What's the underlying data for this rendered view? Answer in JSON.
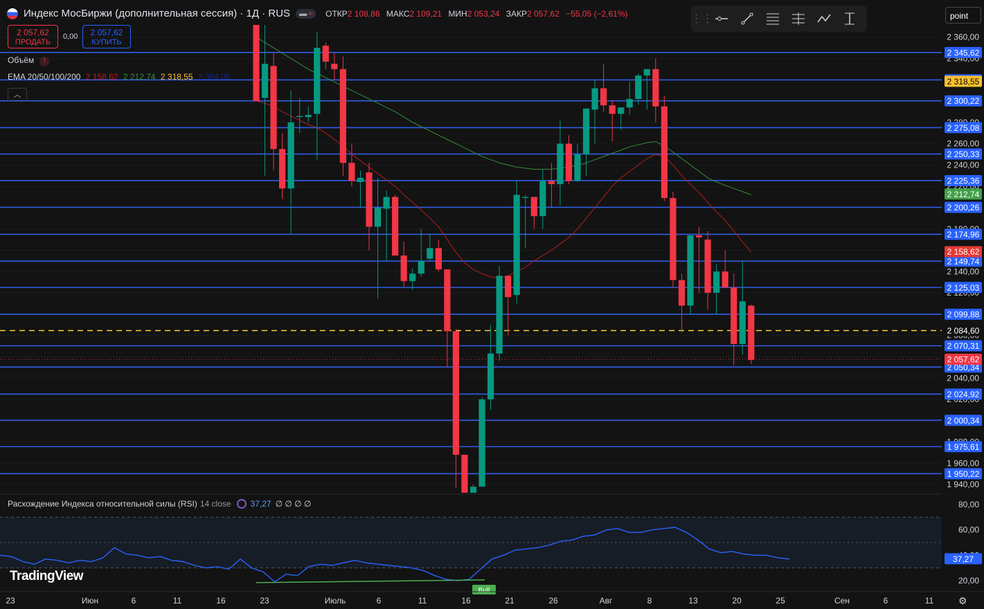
{
  "header": {
    "title": "Индекс МосБиржи (дополнительная сессия) · 1Д · RUS",
    "pill_icon": "wave-icon",
    "open_label": "ОТКР",
    "open": "2 108,86",
    "high_label": "МАКС",
    "high": "2 109,21",
    "low_label": "МИН",
    "low": "2 053,24",
    "close_label": "ЗАКР",
    "close": "2 057,62",
    "change": "−55,05 (−2,61%)"
  },
  "trade": {
    "sell_price": "2 057,62",
    "sell_label": "ПРОДАТЬ",
    "spread": "0,00",
    "buy_price": "2 057,62",
    "buy_label": "КУПИТЬ"
  },
  "indicators": {
    "volume_label": "Объём",
    "volume_error": "!",
    "ema_label": "EMA 20/50/100/200",
    "ema_values": [
      "2 158,62",
      "2 212,74",
      "2 318,55",
      "2 384,05"
    ],
    "ema_colors": [
      "#b71c1c",
      "#388e3c",
      "#fbc02d",
      "#1a237e"
    ]
  },
  "toolbar": {
    "icons": [
      "horizontal-ray-icon",
      "trend-line-icon",
      "fib-retracement-icon",
      "pitchfork-icon",
      "path-icon",
      "price-range-icon"
    ],
    "mode_label": "point"
  },
  "rsi": {
    "title": "Расхождение Индекса относительной силы (RSI)",
    "params": "14 close",
    "value": "37,27",
    "extras": "∅ ∅ ∅ ∅",
    "axis_labels": [
      "80,00",
      "60,00",
      "40,00",
      "20,00"
    ],
    "current_label": "37,27",
    "bull_label": "Bull"
  },
  "logo": "TradingView",
  "settings_icon": "gear-icon",
  "chart_data": {
    "type": "candlestick",
    "series": [
      {
        "name": "Индекс МосБиржи (дополнительная сессия)",
        "ohlc": [
          [
            2380,
            2400,
            2300,
            2300
          ],
          [
            2303,
            2385,
            2230,
            2335
          ],
          [
            2333,
            2345,
            2235,
            2255
          ],
          [
            2255,
            2270,
            2208,
            2218
          ],
          [
            2218,
            2310,
            2175,
            2280
          ],
          [
            2285,
            2303,
            2270,
            2286
          ],
          [
            2285,
            2295,
            2280,
            2287
          ],
          [
            2288,
            2365,
            2245,
            2350
          ],
          [
            2352,
            2355,
            2330,
            2337
          ],
          [
            2335,
            2345,
            2320,
            2330
          ],
          [
            2330,
            2342,
            2230,
            2242
          ],
          [
            2242,
            2260,
            2220,
            2225
          ],
          [
            2224,
            2235,
            2200,
            2228
          ],
          [
            2233,
            2242,
            2160,
            2182
          ],
          [
            2182,
            2228,
            2115,
            2200
          ],
          [
            2199,
            2216,
            2150,
            2210
          ],
          [
            2210,
            2212,
            2160,
            2155
          ],
          [
            2155,
            2168,
            2125,
            2131
          ],
          [
            2131,
            2143,
            2123,
            2138
          ],
          [
            2138,
            2180,
            2135,
            2150
          ],
          [
            2152,
            2175,
            2150,
            2162
          ],
          [
            2162,
            2170,
            2140,
            2142
          ],
          [
            2142,
            2138,
            2050,
            2084
          ],
          [
            2084,
            2086,
            1937,
            1968
          ],
          [
            1968,
            1935,
            1925,
            1930
          ],
          [
            1930,
            1940,
            1930,
            1938
          ],
          [
            1938,
            2022,
            1939,
            2020
          ],
          [
            2020,
            2090,
            2010,
            2063
          ],
          [
            2063,
            2145,
            2056,
            2136
          ],
          [
            2136,
            2110,
            2080,
            2116
          ],
          [
            2118,
            2225,
            2110,
            2212
          ],
          [
            2210,
            2212,
            2162,
            2210
          ],
          [
            2210,
            2198,
            2180,
            2192
          ],
          [
            2192,
            2236,
            2180,
            2225
          ],
          [
            2225,
            2242,
            2200,
            2222
          ],
          [
            2222,
            2282,
            2202,
            2260
          ],
          [
            2260,
            2268,
            2222,
            2225
          ],
          [
            2225,
            2260,
            2224,
            2250
          ],
          [
            2250,
            2290,
            2230,
            2293
          ],
          [
            2292,
            2320,
            2260,
            2312
          ],
          [
            2312,
            2335,
            2290,
            2296
          ],
          [
            2296,
            2301,
            2262,
            2288
          ],
          [
            2288,
            2294,
            2273,
            2294
          ],
          [
            2294,
            2318,
            2287,
            2302
          ],
          [
            2302,
            2326,
            2297,
            2324
          ],
          [
            2324,
            2330,
            2292,
            2330
          ],
          [
            2330,
            2340,
            2280,
            2295
          ],
          [
            2295,
            2305,
            2206,
            2209
          ],
          [
            2209,
            2215,
            2125,
            2132
          ],
          [
            2132,
            2138,
            2083,
            2108
          ],
          [
            2108,
            2168,
            2100,
            2174
          ],
          [
            2174,
            2182,
            2120,
            2172
          ],
          [
            2170,
            2178,
            2104,
            2120
          ],
          [
            2120,
            2147,
            2100,
            2140
          ],
          [
            2140,
            2160,
            2125,
            2125
          ],
          [
            2125,
            2138,
            2052,
            2072
          ],
          [
            2072,
            2150,
            2062,
            2112
          ],
          [
            2108,
            2109,
            2053,
            2057
          ]
        ]
      }
    ],
    "x_ticks": [
      "23",
      "Июн",
      "6",
      "11",
      "16",
      "23",
      "Июль",
      "6",
      "11",
      "16",
      "21",
      "26",
      "Авг",
      "8",
      "13",
      "20",
      "25",
      "Сен",
      "6",
      "11"
    ],
    "y_ticks": [
      "2 360,00",
      "2 340,00",
      "2 320,00",
      "2 300,00",
      "2 280,00",
      "2 260,00",
      "2 240,00",
      "2 220,00",
      "2 200,00",
      "2 180,00",
      "2 160,00",
      "2 140,00",
      "2 120,00",
      "2 100,00",
      "2 080,00",
      "2 060,00",
      "2 040,00",
      "2 020,00",
      "2 000,00",
      "1 980,00",
      "1 960,00",
      "1 940,00"
    ],
    "horizontal_levels": [
      "2 345,62",
      "2 319,90",
      "2 300,22",
      "2 275,08",
      "2 250,33",
      "2 225,36",
      "2 200,26",
      "2 174,96",
      "2 149,74",
      "2 125,03",
      "2 099,88",
      "2 070,31",
      "2 050,34",
      "2 024,92",
      "2 000,34",
      "1 975,61",
      "1 950,22"
    ],
    "dashed_level": "2 084,60",
    "last_price": "2 057,62",
    "ema_labels": {
      "ema20": "2 158,62",
      "ema50": "2 212,74",
      "ema100": "2 318,55"
    },
    "ema20": [
      2300,
      2298,
      2295,
      2290,
      2286,
      2282,
      2278,
      2275,
      2270,
      2264,
      2258,
      2250,
      2244,
      2238,
      2232,
      2226,
      2220,
      2212,
      2205,
      2198,
      2190,
      2182,
      2170,
      2158,
      2148,
      2142,
      2138,
      2135,
      2134,
      2136,
      2140,
      2144,
      2150,
      2155,
      2160,
      2166,
      2172,
      2180,
      2190,
      2200,
      2210,
      2220,
      2228,
      2234,
      2240,
      2246,
      2250,
      2248,
      2240,
      2230,
      2222,
      2214,
      2205,
      2196,
      2188,
      2178,
      2168,
      2158
    ],
    "ema50": [
      2360,
      2355,
      2350,
      2345,
      2340,
      2335,
      2330,
      2326,
      2322,
      2318,
      2314,
      2310,
      2306,
      2302,
      2298,
      2294,
      2290,
      2285,
      2280,
      2276,
      2272,
      2268,
      2264,
      2260,
      2256,
      2252,
      2248,
      2245,
      2242,
      2240,
      2238,
      2237,
      2236,
      2236,
      2236,
      2237,
      2238,
      2240,
      2242,
      2245,
      2248,
      2251,
      2254,
      2257,
      2259,
      2261,
      2262,
      2258,
      2252,
      2246,
      2240,
      2234,
      2228,
      2224,
      2221,
      2218,
      2215,
      2212
    ],
    "ema100_label": "2 318,55",
    "rsi_values": [
      40,
      39,
      35,
      33,
      37,
      36,
      34,
      36,
      35,
      38,
      46,
      41,
      40,
      38,
      39,
      36,
      35,
      32,
      30,
      31,
      29,
      37,
      30,
      27,
      19,
      25,
      24,
      31,
      33,
      32,
      34,
      36,
      34,
      33,
      32,
      31,
      30,
      28,
      24,
      21,
      20,
      21,
      29,
      37,
      40,
      44,
      45,
      46,
      48,
      51,
      52,
      55,
      56,
      60,
      61,
      58,
      58,
      60,
      61,
      62,
      58,
      52,
      45,
      42,
      43,
      41,
      40,
      40,
      38,
      37
    ],
    "rsi_levels": [
      70,
      50,
      30
    ],
    "rsi_ylim": [
      10,
      85
    ]
  }
}
